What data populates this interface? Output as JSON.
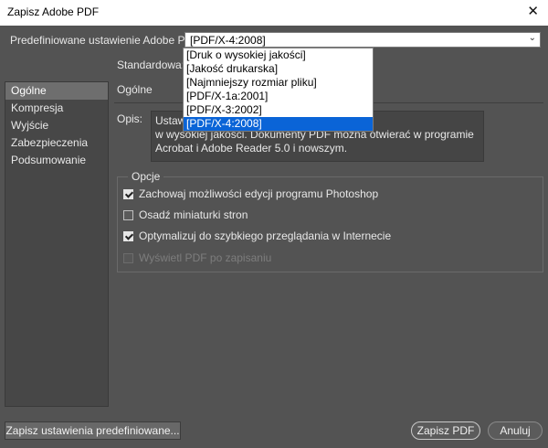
{
  "window": {
    "title": "Zapisz Adobe PDF",
    "close_glyph": "✕"
  },
  "preset": {
    "label": "Predefiniowane ustawienie Adobe PDF:",
    "value": "[PDF/X-4:2008]",
    "options": [
      "[Druk o wysokiej jakości]",
      "[Jakość drukarska]",
      "[Najmniejszy rozmiar pliku]",
      "[PDF/X-1a:2001]",
      "[PDF/X-3:2002]",
      "[PDF/X-4:2008]"
    ],
    "selected_index": 5
  },
  "standard": {
    "label": "Standardowa:"
  },
  "sidebar": {
    "items": [
      {
        "label": "Ogólne",
        "active": true
      },
      {
        "label": "Kompresja"
      },
      {
        "label": "Wyjście"
      },
      {
        "label": "Zabezpieczenia"
      },
      {
        "label": "Podsumowanie"
      }
    ]
  },
  "main": {
    "section_title": "Ogólne",
    "description_label": "Opis:",
    "description_line1": "Ustawi",
    "description_line2": "w wysokiej jakości. Dokumenty PDF można otwierać w programie",
    "description_line3": "Acrobat i Adobe Reader 5.0 i nowszym."
  },
  "options": {
    "legend": "Opcje",
    "items": [
      {
        "label": "Zachowaj możliwości edycji programu Photoshop",
        "checked": true
      },
      {
        "label": "Osadź miniaturki stron",
        "checked": false
      },
      {
        "label": "Optymalizuj do szybkiego przeglądania w Internecie",
        "checked": true
      },
      {
        "label": "Wyświetl PDF po zapisaniu",
        "checked": false,
        "disabled": true
      }
    ]
  },
  "buttons": {
    "save_preset": "Zapisz ustawienia predefiniowane...",
    "save_pdf": "Zapisz PDF",
    "cancel": "Anuluj"
  },
  "colors": {
    "background": "#535353",
    "selection": "#0a64d7"
  },
  "icons": {
    "close": "close-icon",
    "dropdown": "chevron-down-icon",
    "check": "checkmark-icon"
  }
}
